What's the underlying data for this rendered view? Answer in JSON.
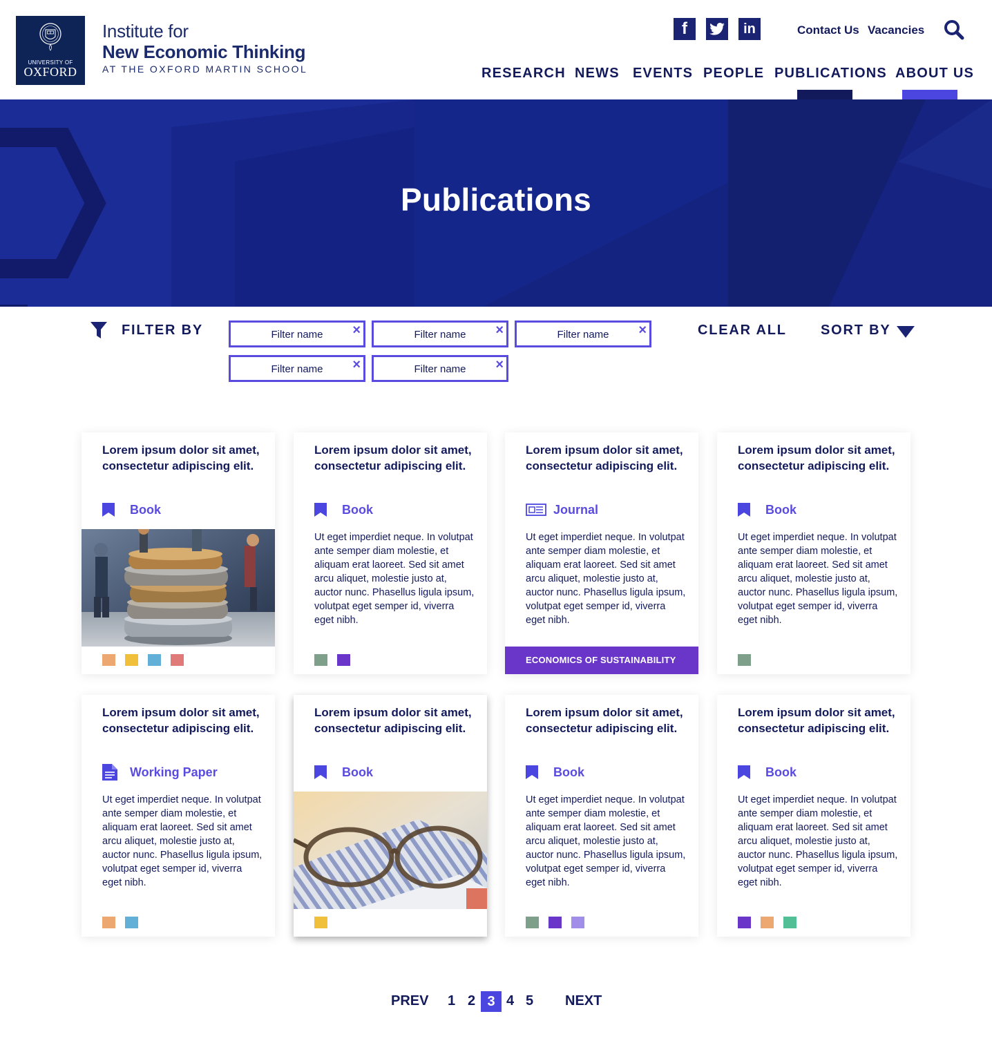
{
  "header": {
    "logo_small": "UNIVERSITY OF",
    "logo_big": "OXFORD",
    "institute_line1": "Institute for",
    "institute_line2": "New Economic Thinking",
    "institute_line3": "AT THE OXFORD MARTIN SCHOOL",
    "social": [
      {
        "name": "facebook",
        "glyph": "f"
      },
      {
        "name": "twitter",
        "glyph": ""
      },
      {
        "name": "linkedin",
        "glyph": "in"
      }
    ],
    "links": [
      "Contact Us",
      "Vacancies"
    ],
    "nav": [
      "RESEARCH",
      "NEWS",
      "EVENTS",
      "PEOPLE",
      "PUBLICATIONS",
      "ABOUT US"
    ],
    "active_nav": "PUBLICATIONS",
    "nav_hover": "ABOUT US"
  },
  "hero": {
    "title": "Publications"
  },
  "filters": {
    "label": "FILTER BY",
    "chips": [
      "Filter name",
      "Filter name",
      "Filter name",
      "Filter name",
      "Filter name"
    ],
    "clear_all": "CLEAR ALL",
    "sort_by": "SORT BY"
  },
  "colors": {
    "navy": "#131a5c",
    "accent": "#5a4be0",
    "hero": "#162a8c",
    "tag": "#6a35c9",
    "sw_orange": "#eca870",
    "sw_yellow": "#f0c03a",
    "sw_blue": "#62b0d8",
    "sw_red": "#e07a78",
    "sw_green": "#7ea08a",
    "sw_purple": "#6a35c9",
    "sw_lavender": "#a18ee8",
    "sw_teal": "#52bf96"
  },
  "cards": [
    {
      "title": "Lorem ipsum dolor sit amet, consectetur adipiscing elit.",
      "type": "Book",
      "icon": "bookmark-icon",
      "body": "",
      "image": "coins-photo",
      "tag": "",
      "swatches": [
        "#eca870",
        "#f0c03a",
        "#62b0d8",
        "#e07a78"
      ]
    },
    {
      "title": "Lorem ipsum dolor sit amet, consectetur adipiscing elit.",
      "type": "Book",
      "icon": "bookmark-icon",
      "body": "Ut eget imperdiet neque. In volutpat ante semper diam molestie, et aliquam erat laoreet. Sed sit amet arcu aliquet, molestie justo at, auctor nunc. Phasellus ligula ipsum, volutpat eget semper id, viverra eget nibh.",
      "image": "",
      "tag": "",
      "swatches": [
        "#7ea08a",
        "#6a35c9"
      ]
    },
    {
      "title": "Lorem ipsum dolor sit amet, consectetur adipiscing elit.",
      "type": "Journal",
      "icon": "newspaper-icon",
      "body": "Ut eget imperdiet neque. In volutpat ante semper diam molestie, et aliquam erat laoreet. Sed sit amet arcu aliquet, molestie justo at, auctor nunc. Phasellus ligula ipsum, volutpat eget semper id, viverra eget nibh.",
      "image": "",
      "tag": "ECONOMICS OF SUSTAINABILITY",
      "swatches": []
    },
    {
      "title": "Lorem ipsum dolor sit amet, consectetur adipiscing elit.",
      "type": "Book",
      "icon": "bookmark-icon",
      "body": "Ut eget imperdiet neque. In volutpat ante semper diam molestie, et aliquam erat laoreet. Sed sit amet arcu aliquet, molestie justo at, auctor nunc. Phasellus ligula ipsum, volutpat eget semper id, viverra eget nibh.",
      "image": "",
      "tag": "",
      "swatches": [
        "#7ea08a"
      ]
    },
    {
      "title": "Lorem ipsum dolor sit amet, consectetur adipiscing elit.",
      "type": "Working Paper",
      "icon": "document-icon",
      "body": "Ut eget imperdiet neque. In volutpat ante semper diam molestie, et aliquam erat laoreet. Sed sit amet arcu aliquet, molestie justo at, auctor nunc. Phasellus ligula ipsum, volutpat eget semper id, viverra eget nibh.",
      "image": "",
      "tag": "",
      "swatches": [
        "#eca870",
        "#62b0d8"
      ]
    },
    {
      "title": "Lorem ipsum dolor sit amet, consectetur adipiscing elit.",
      "type": "Book",
      "icon": "bookmark-icon",
      "body": "",
      "image": "glasses-photo",
      "tag": "",
      "swatches": [
        "#f0c03a"
      ]
    },
    {
      "title": "Lorem ipsum dolor sit amet, consectetur adipiscing elit.",
      "type": "Book",
      "icon": "bookmark-icon",
      "body": "Ut eget imperdiet neque. In volutpat ante semper diam molestie, et aliquam erat laoreet. Sed sit amet arcu aliquet, molestie justo at, auctor nunc. Phasellus ligula ipsum, volutpat eget semper id, viverra eget nibh.",
      "image": "",
      "tag": "",
      "swatches": [
        "#7ea08a",
        "#6a35c9",
        "#a18ee8"
      ]
    },
    {
      "title": "Lorem ipsum dolor sit amet, consectetur adipiscing elit.",
      "type": "Book",
      "icon": "bookmark-icon",
      "body": "Ut eget imperdiet neque. In volutpat ante semper diam molestie, et aliquam erat laoreet. Sed sit amet arcu aliquet, molestie justo at, auctor nunc. Phasellus ligula ipsum, volutpat eget semper id, viverra eget nibh.",
      "image": "",
      "tag": "",
      "swatches": [
        "#6a35c9",
        "#eca870",
        "#52bf96"
      ]
    }
  ],
  "pagination": {
    "prev": "PREV",
    "pages": [
      "1",
      "2",
      "3",
      "4",
      "5"
    ],
    "current": "3",
    "next": "NEXT"
  }
}
